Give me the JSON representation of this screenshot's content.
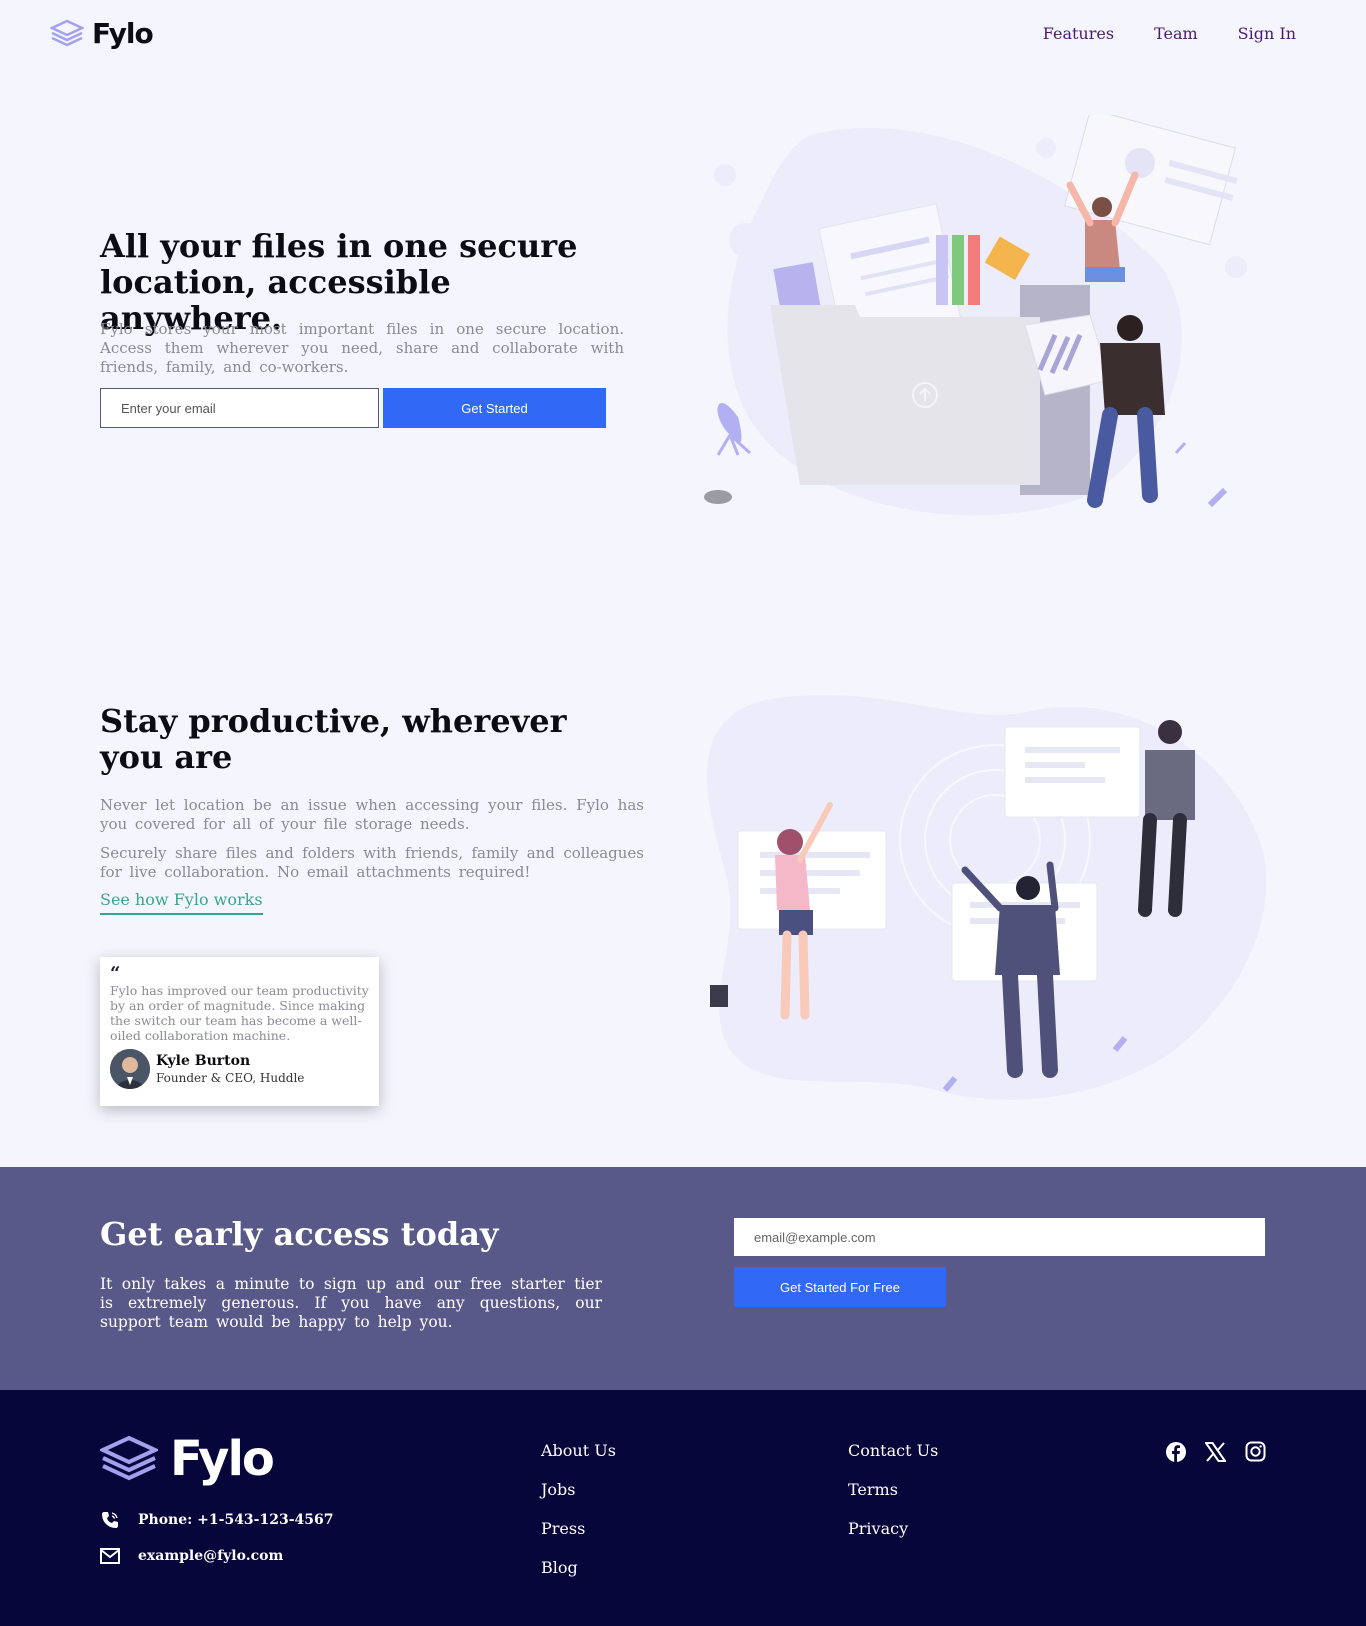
{
  "header": {
    "brand": "Fylo",
    "nav": [
      {
        "label": "Features"
      },
      {
        "label": "Team"
      },
      {
        "label": "Sign In"
      }
    ]
  },
  "hero": {
    "title": "All your files in one secure location, accessible anywhere.",
    "description": "Fylo stores your most important files in one secure location. Access them wherever you need, share and collaborate with friends, family, and co-workers.",
    "email_placeholder": "Enter your email",
    "button_label": "Get Started"
  },
  "productive": {
    "title": "Stay productive, wherever you are",
    "paragraph_1": "Never let location be an issue when accessing your files. Fylo has you covered for all of your file storage needs.",
    "paragraph_2": "Securely share files and folders with friends, family and colleagues for live collaboration. No email attachments required!",
    "link_label": "See how Fylo works"
  },
  "testimonial": {
    "quote_mark": "“",
    "text": "Fylo has improved our team productivity by an order of magnitude. Since making the switch our team has become a well-oiled collaboration machine.",
    "author_name": "Kyle Burton",
    "author_role": "Founder & CEO, Huddle"
  },
  "cta": {
    "title": "Get early access today",
    "description": "It only takes a minute to sign up and our free starter tier is extremely generous. If you have any questions, our support team would be happy to help you.",
    "email_placeholder": "email@example.com",
    "button_label": "Get Started For Free"
  },
  "footer": {
    "brand": "Fylo",
    "phone": "Phone: +1-543-123-4567",
    "email": "example@fylo.com",
    "links_col1": [
      {
        "label": "About Us"
      },
      {
        "label": "Jobs"
      },
      {
        "label": "Press"
      },
      {
        "label": "Blog"
      }
    ],
    "links_col2": [
      {
        "label": "Contact Us"
      },
      {
        "label": "Terms"
      },
      {
        "label": "Privacy"
      }
    ],
    "socials": [
      "facebook-icon",
      "x-icon",
      "instagram-icon"
    ]
  },
  "colors": {
    "background": "#f5f5fe",
    "accent_blue": "#3168f5",
    "cta_bg": "#585989",
    "footer_bg": "#07063a",
    "link_green": "#3ba393",
    "nav_purple": "#4b1b6b"
  }
}
